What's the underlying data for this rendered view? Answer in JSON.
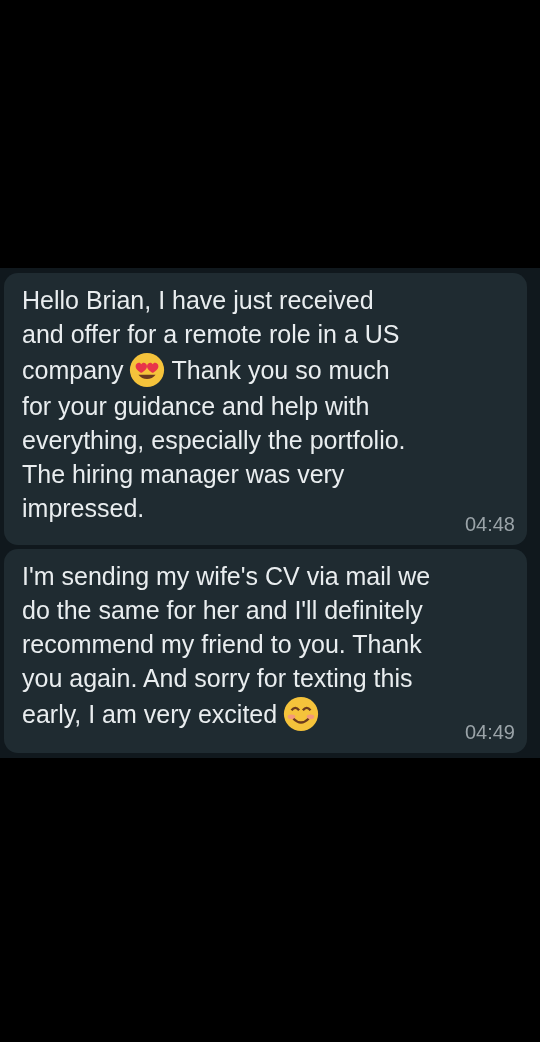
{
  "messages": [
    {
      "lines": [
        [
          {
            "kind": "text",
            "text": "Hello Brian, I have just received"
          }
        ],
        [
          {
            "kind": "text",
            "text": "and offer for a remote role in a US"
          }
        ],
        [
          {
            "kind": "text",
            "text": "company"
          },
          {
            "kind": "heart-eyes"
          },
          {
            "kind": "text",
            "text": "Thank you so much"
          }
        ],
        [
          {
            "kind": "text",
            "text": "for your guidance and help with"
          }
        ],
        [
          {
            "kind": "text",
            "text": "everything, especially the portfolio."
          }
        ],
        [
          {
            "kind": "text",
            "text": "The hiring manager was very"
          }
        ],
        [
          {
            "kind": "text",
            "text": "impressed."
          }
        ]
      ],
      "time": "04:48"
    },
    {
      "lines": [
        [
          {
            "kind": "text",
            "text": "I'm sending my wife's CV via mail we"
          }
        ],
        [
          {
            "kind": "text",
            "text": "do the same for her and I'll definitely"
          }
        ],
        [
          {
            "kind": "text",
            "text": "recommend my friend to you. Thank"
          }
        ],
        [
          {
            "kind": "text",
            "text": "you again. And sorry for texting this"
          }
        ],
        [
          {
            "kind": "text",
            "text": "early, I am very excited"
          },
          {
            "kind": "smile"
          }
        ]
      ],
      "time": "04:49"
    }
  ]
}
